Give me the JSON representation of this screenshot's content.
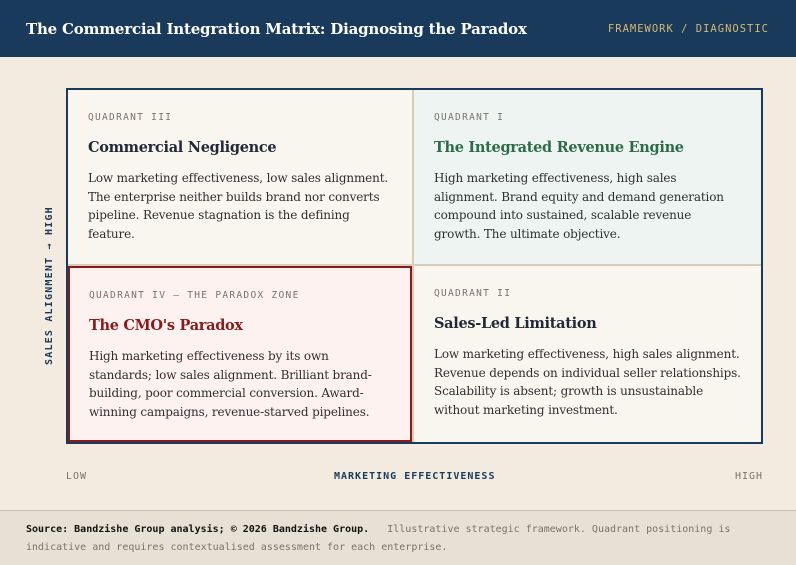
{
  "header": {
    "title": "The Commercial Integration Matrix: Diagnosing the Paradox",
    "tag": "FRAMEWORK / DIAGNOSTIC"
  },
  "axes": {
    "y_label": "SALES ALIGNMENT → HIGH",
    "x_low": "LOW",
    "x_label": "MARKETING EFFECTIVENESS",
    "x_high": "HIGH"
  },
  "quadrants": {
    "q3": {
      "label": "QUADRANT III",
      "title": "Commercial Negligence",
      "body": "Low marketing effectiveness, low sales alignment. The enterprise neither builds brand nor converts pipeline. Revenue stagnation is the defining feature."
    },
    "q1": {
      "label": "QUADRANT I",
      "title": "The Integrated Revenue Engine",
      "body": "High marketing effectiveness, high sales alignment. Brand equity and demand generation compound into sustained, scalable revenue growth. The ultimate objective."
    },
    "q4": {
      "label": "QUADRANT IV — THE PARADOX ZONE",
      "title": "The CMO's Paradox",
      "body": "High marketing effectiveness by its own standards; low sales alignment. Brilliant brand-building, poor commercial conversion. Award-winning campaigns, revenue-starved pipelines."
    },
    "q2": {
      "label": "QUADRANT II",
      "title": "Sales-Led Limitation",
      "body": "Low marketing effectiveness, high sales alignment. Revenue depends on individual seller relationships. Scalability is absent; growth is unsustainable without marketing investment."
    }
  },
  "footer": {
    "source": "Source: Bandzishe Group analysis; © 2026 Bandzishe Group.",
    "note": "Illustrative strategic framework. Quadrant positioning is indicative and requires contextualised assessment for each enterprise."
  },
  "colors": {
    "navy": "#1a3a5c",
    "gold": "#d4b872",
    "green": "#2e6b4a",
    "red": "#8b1a1a"
  }
}
